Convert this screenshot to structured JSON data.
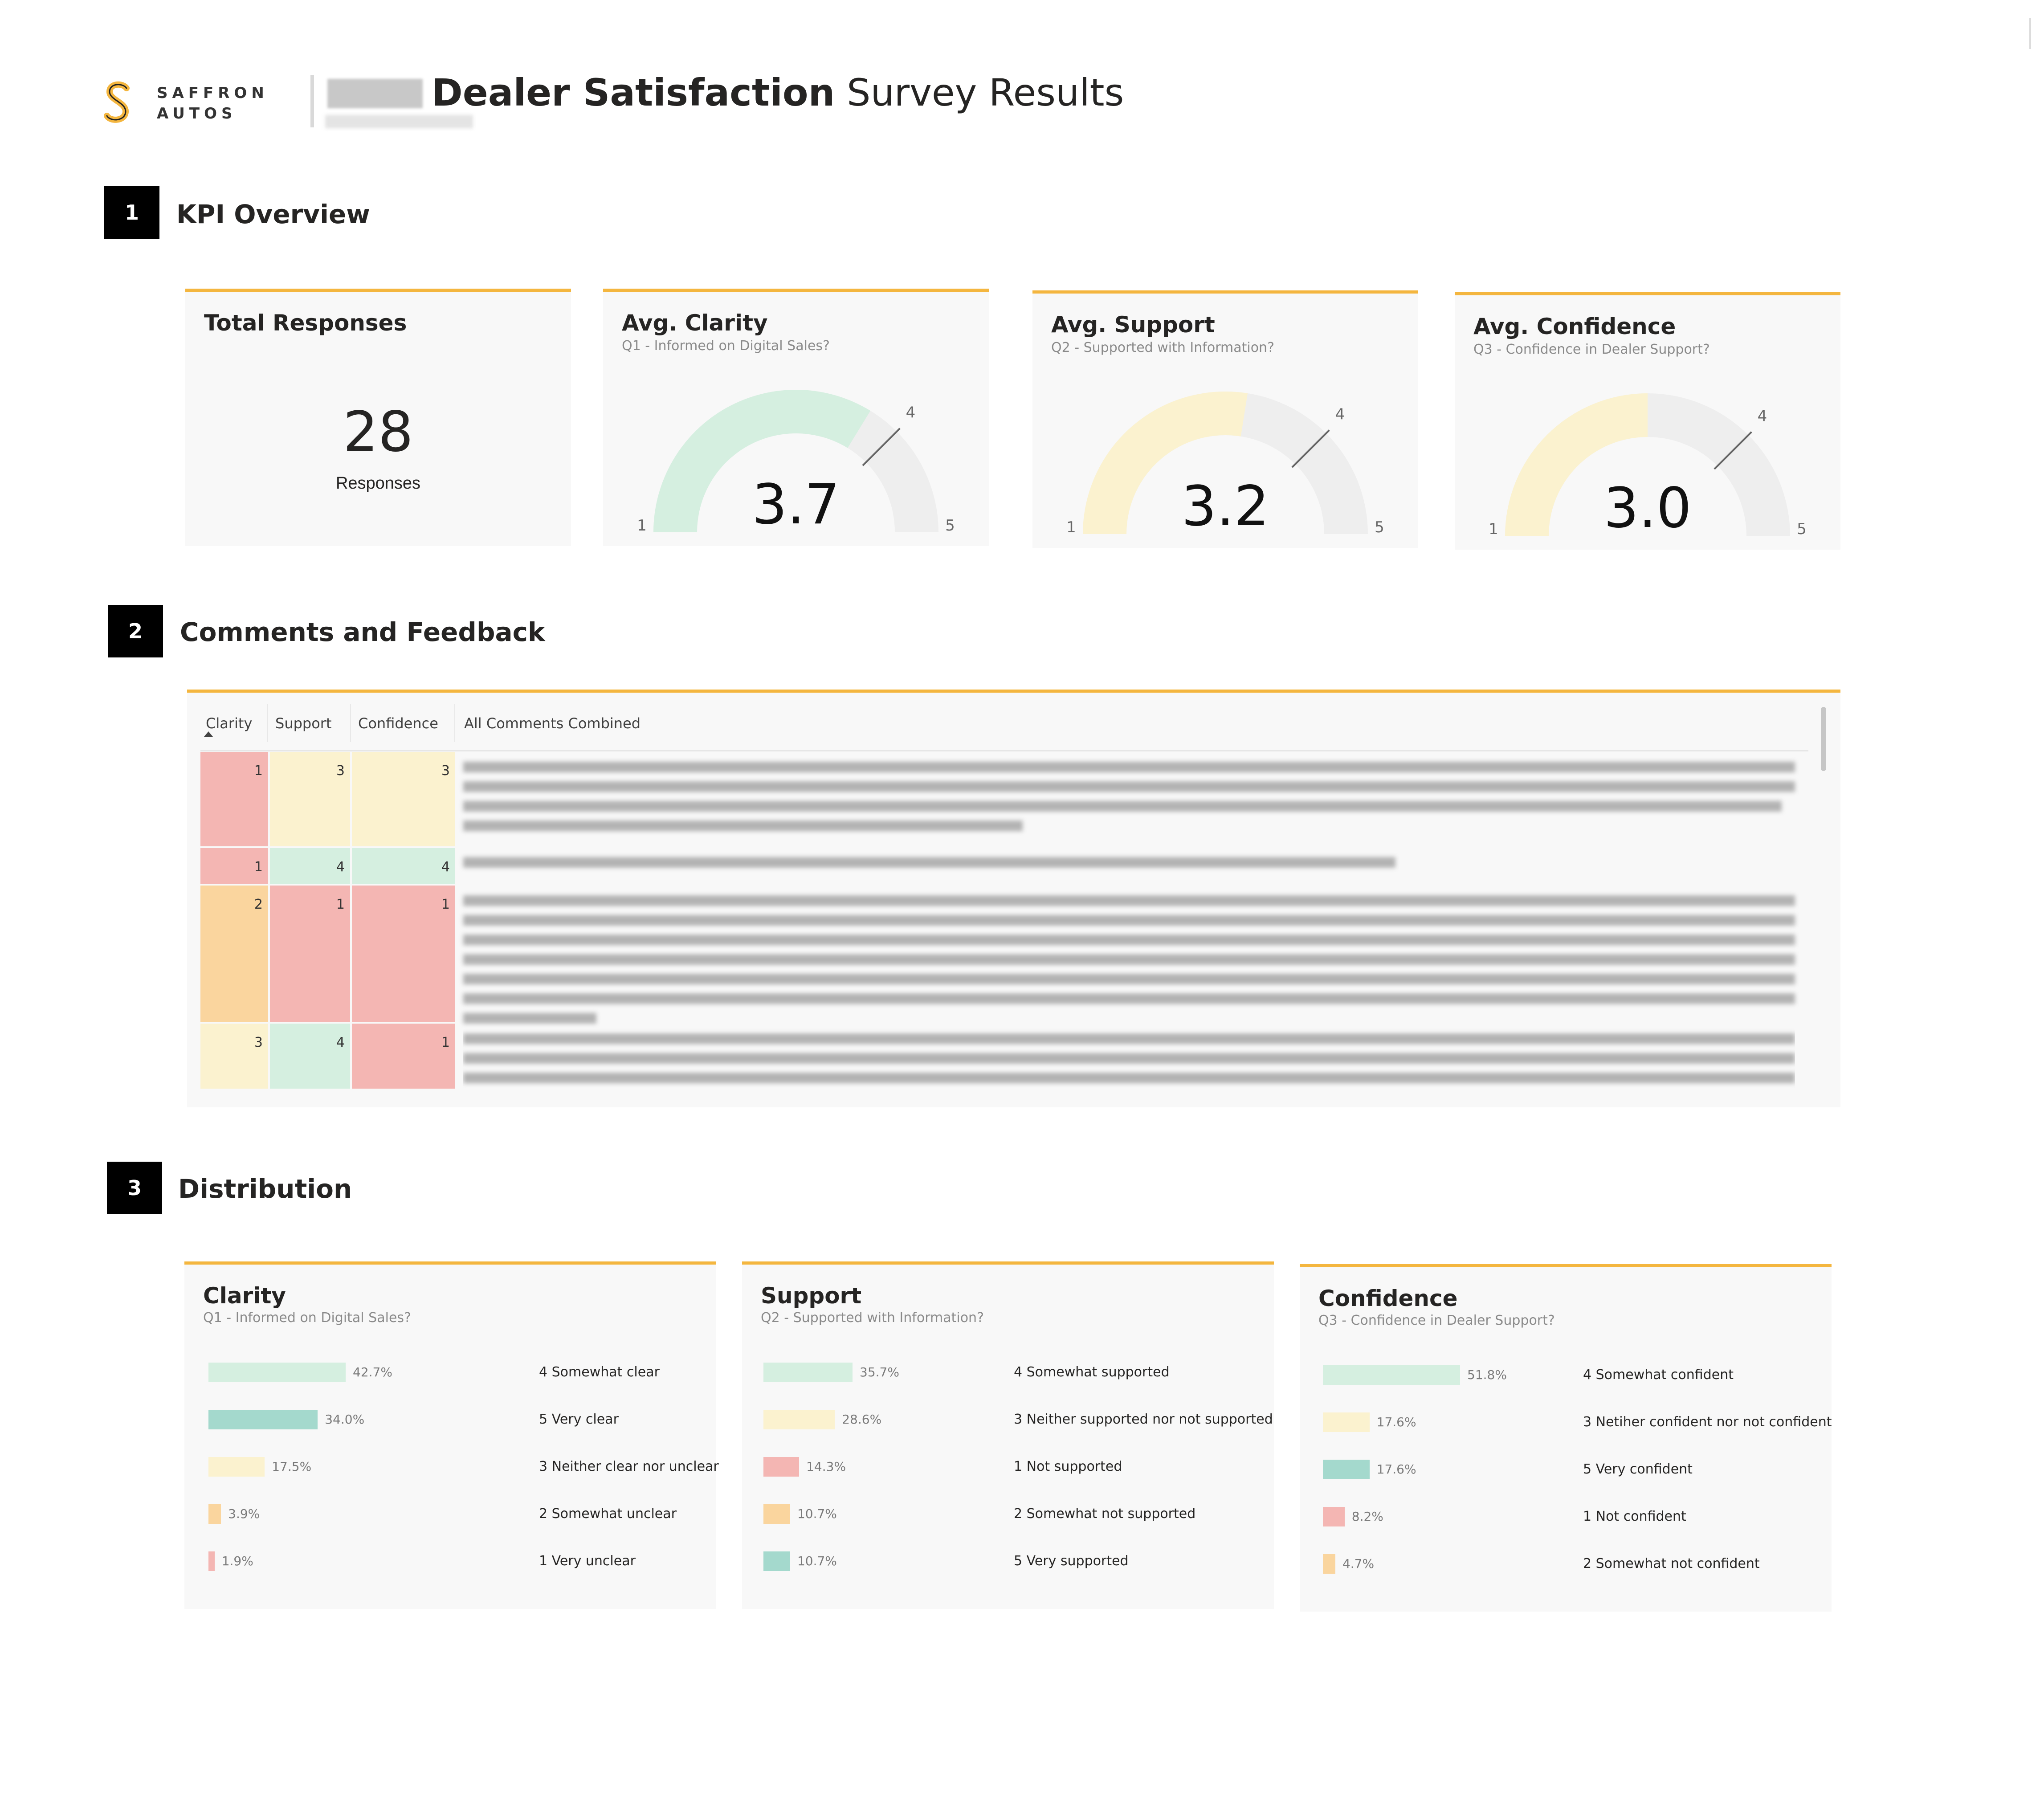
{
  "header": {
    "brand_line1": "SAFFRON",
    "brand_line2": "AUTOS",
    "title_bold": "Dealer Satisfaction",
    "title_rest": " Survey Results"
  },
  "sections": [
    {
      "number": "1",
      "title": "KPI Overview"
    },
    {
      "number": "2",
      "title": "Comments and Feedback"
    },
    {
      "number": "3",
      "title": "Distribution"
    }
  ],
  "kpis": {
    "total": {
      "title": "Total Responses",
      "value": "28",
      "label": "Responses"
    },
    "gauges": [
      {
        "title": "Avg. Clarity",
        "subtitle": "Q1 - Informed on Digital Sales?",
        "value": 3.7,
        "value_text": "3.7",
        "min": "1",
        "max": "5",
        "target": "4",
        "fill_color": "#d5efe0"
      },
      {
        "title": "Avg. Support",
        "subtitle": "Q2 - Supported with Information?",
        "value": 3.2,
        "value_text": "3.2",
        "min": "1",
        "max": "5",
        "target": "4",
        "fill_color": "#fbf2cf"
      },
      {
        "title": "Avg. Confidence",
        "subtitle": "Q3 - Confidence in Dealer Support?",
        "value": 3.0,
        "value_text": "3.0",
        "min": "1",
        "max": "5",
        "target": "4",
        "fill_color": "#fbf2cf"
      }
    ]
  },
  "comments_table": {
    "columns": [
      "Clarity",
      "Support",
      "Confidence",
      "All Comments Combined"
    ],
    "sorted_column": "Clarity",
    "rows": [
      {
        "clarity": "1",
        "support": "3",
        "confidence": "3",
        "colors": [
          "#f4b6b3",
          "#fbf2cf",
          "#fbf2cf"
        ]
      },
      {
        "clarity": "1",
        "support": "4",
        "confidence": "4",
        "colors": [
          "#f4b6b3",
          "#d5efe0",
          "#d5efe0"
        ]
      },
      {
        "clarity": "2",
        "support": "1",
        "confidence": "1",
        "colors": [
          "#fad59e",
          "#f4b6b3",
          "#f4b6b3"
        ]
      },
      {
        "clarity": "3",
        "support": "4",
        "confidence": "1",
        "colors": [
          "#fbf2cf",
          "#d5efe0",
          "#f4b6b3"
        ]
      }
    ]
  },
  "distribution": [
    {
      "title": "Clarity",
      "subtitle": "Q1 - Informed on Digital Sales?",
      "items": [
        {
          "pct": 42.7,
          "pct_text": "42.7%",
          "label": "4 Somewhat clear",
          "color": "#d5efe0"
        },
        {
          "pct": 34.0,
          "pct_text": "34.0%",
          "label": "5 Very clear",
          "color": "#a4d9cd"
        },
        {
          "pct": 17.5,
          "pct_text": "17.5%",
          "label": "3 Neither clear nor unclear",
          "color": "#fbf2cf"
        },
        {
          "pct": 3.9,
          "pct_text": "3.9%",
          "label": "2 Somewhat unclear",
          "color": "#fad59e"
        },
        {
          "pct": 1.9,
          "pct_text": "1.9%",
          "label": "1 Very unclear",
          "color": "#f4b6b3"
        }
      ]
    },
    {
      "title": "Support",
      "subtitle": "Q2 - Supported with Information?",
      "items": [
        {
          "pct": 35.7,
          "pct_text": "35.7%",
          "label": "4 Somewhat supported",
          "color": "#d5efe0"
        },
        {
          "pct": 28.6,
          "pct_text": "28.6%",
          "label": "3 Neither supported nor not supported",
          "color": "#fbf2cf"
        },
        {
          "pct": 14.3,
          "pct_text": "14.3%",
          "label": "1 Not supported",
          "color": "#f4b6b3"
        },
        {
          "pct": 10.7,
          "pct_text": "10.7%",
          "label": "2 Somewhat not supported",
          "color": "#fad59e"
        },
        {
          "pct": 10.7,
          "pct_text": "10.7%",
          "label": "5 Very supported",
          "color": "#a4d9cd"
        }
      ]
    },
    {
      "title": "Confidence",
      "subtitle": "Q3 - Confidence in Dealer Support?",
      "items": [
        {
          "pct": 51.8,
          "pct_text": "51.8%",
          "label": "4 Somewhat confident",
          "color": "#d5efe0"
        },
        {
          "pct": 17.6,
          "pct_text": "17.6%",
          "label": "3 Netiher confident nor not confident",
          "color": "#fbf2cf"
        },
        {
          "pct": 17.6,
          "pct_text": "17.6%",
          "label": "5 Very confident",
          "color": "#a4d9cd"
        },
        {
          "pct": 8.2,
          "pct_text": "8.2%",
          "label": "1 Not confident",
          "color": "#f4b6b3"
        },
        {
          "pct": 4.7,
          "pct_text": "4.7%",
          "label": "2 Somewhat not confident",
          "color": "#fad59e"
        }
      ]
    }
  ]
}
